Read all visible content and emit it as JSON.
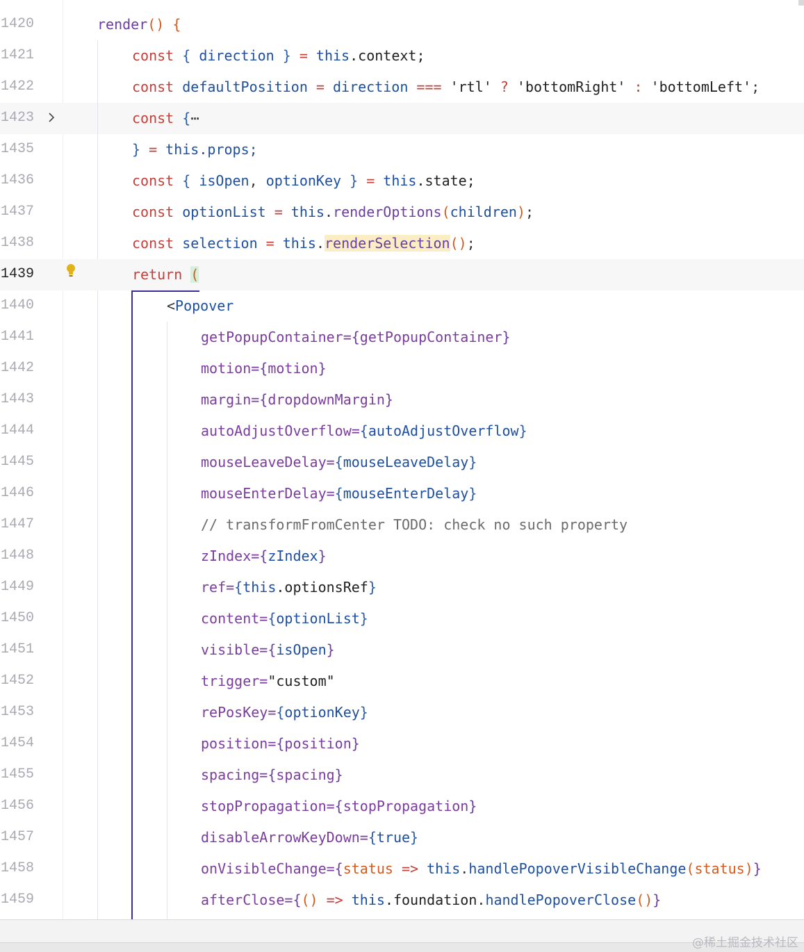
{
  "editor": {
    "current_line": "1439",
    "lines": [
      {
        "num": "1420",
        "hl": false
      },
      {
        "num": "1421",
        "hl": false
      },
      {
        "num": "1422",
        "hl": false
      },
      {
        "num": "1423",
        "hl": true,
        "folded": true
      },
      {
        "num": "1435",
        "hl": false
      },
      {
        "num": "1436",
        "hl": false
      },
      {
        "num": "1437",
        "hl": false
      },
      {
        "num": "1438",
        "hl": false
      },
      {
        "num": "1439",
        "hl": true,
        "current": true,
        "lightbulb": true
      },
      {
        "num": "1440",
        "hl": false
      },
      {
        "num": "1441",
        "hl": false
      },
      {
        "num": "1442",
        "hl": false
      },
      {
        "num": "1443",
        "hl": false
      },
      {
        "num": "1444",
        "hl": false
      },
      {
        "num": "1445",
        "hl": false
      },
      {
        "num": "1446",
        "hl": false
      },
      {
        "num": "1447",
        "hl": false
      },
      {
        "num": "1448",
        "hl": false
      },
      {
        "num": "1449",
        "hl": false
      },
      {
        "num": "1450",
        "hl": false
      },
      {
        "num": "1451",
        "hl": false
      },
      {
        "num": "1452",
        "hl": false
      },
      {
        "num": "1453",
        "hl": false
      },
      {
        "num": "1454",
        "hl": false
      },
      {
        "num": "1455",
        "hl": false
      },
      {
        "num": "1456",
        "hl": false
      },
      {
        "num": "1457",
        "hl": false
      },
      {
        "num": "1458",
        "hl": false
      },
      {
        "num": "1459",
        "hl": false
      }
    ],
    "code": {
      "l1420": {
        "fn": "render",
        "p1": "()",
        "b": " {"
      },
      "l1421": {
        "kw": "const",
        "o": " { ",
        "v": "direction",
        "c": " } ",
        "eq": "=",
        "th": " this",
        "rest": ".context;"
      },
      "l1422": {
        "kw": "const",
        "v1": " defaultPosition ",
        "eq": "=",
        "v2": " direction ",
        "op": "===",
        "s1": " 'rtl' ",
        "q": "?",
        "s2": " 'bottomRight' ",
        "col": ":",
        "s3": " 'bottomLeft'",
        "end": ";"
      },
      "l1423": {
        "kw": "const",
        "b": " {",
        "ell": "⋯"
      },
      "l1435": {
        "b": "} ",
        "eq": "=",
        "th": " this",
        "rest": ".props;"
      },
      "l1436": {
        "kw": "const",
        "o": " { ",
        "v1": "isOpen",
        "cm": ", ",
        "v2": "optionKey",
        "c": " } ",
        "eq": "=",
        "th": " this",
        "rest": ".state;"
      },
      "l1437": {
        "kw": "const",
        "v": " optionList ",
        "eq": "=",
        "th": " this",
        "dot": ".",
        "m": "renderOptions",
        "p1": "(",
        "arg": "children",
        "p2": ")",
        "end": ";"
      },
      "l1438": {
        "kw": "const",
        "v": " selection ",
        "eq": "=",
        "th": " this",
        "dot": ".",
        "m": "renderSelection",
        "p": "()",
        "end": ";"
      },
      "l1439": {
        "kw": "return",
        "sp": " ",
        "p": "("
      },
      "l1440": {
        "lt": "<",
        "tag": "Popover"
      },
      "l1441": {
        "a": "getPopupContainer=",
        "bo": "{",
        "v": "getPopupContainer",
        "bc": "}"
      },
      "l1442": {
        "a": "motion=",
        "bo": "{",
        "v": "motion",
        "bc": "}"
      },
      "l1443": {
        "a": "margin=",
        "bo": "{",
        "v": "dropdownMargin",
        "bc": "}"
      },
      "l1444": {
        "a": "autoAdjustOverflow=",
        "bo": "{",
        "v": "autoAdjustOverflow",
        "bc": "}"
      },
      "l1445": {
        "a": "mouseLeaveDelay=",
        "bo": "{",
        "v": "mouseLeaveDelay",
        "bc": "}"
      },
      "l1446": {
        "a": "mouseEnterDelay=",
        "bo": "{",
        "v": "mouseEnterDelay",
        "bc": "}"
      },
      "l1447": {
        "cmt": "// transformFromCenter TODO: check no such property"
      },
      "l1448": {
        "a": "zIndex=",
        "bo": "{",
        "v": "zIndex",
        "bc": "}"
      },
      "l1449": {
        "a": "ref=",
        "bo": "{",
        "th": "this",
        "rest": ".optionsRef",
        "bc": "}"
      },
      "l1450": {
        "a": "content=",
        "bo": "{",
        "v": "optionList",
        "bc": "}"
      },
      "l1451": {
        "a": "visible=",
        "bo": "{",
        "v": "isOpen",
        "bc": "}"
      },
      "l1452": {
        "a": "trigger=",
        "s": "\"custom\""
      },
      "l1453": {
        "a": "rePosKey=",
        "bo": "{",
        "v": "optionKey",
        "bc": "}"
      },
      "l1454": {
        "a": "position=",
        "bo": "{",
        "v": "position",
        "bc": "}"
      },
      "l1455": {
        "a": "spacing=",
        "bo": "{",
        "v": "spacing",
        "bc": "}"
      },
      "l1456": {
        "a": "stopPropagation=",
        "bo": "{",
        "v": "stopPropagation",
        "bc": "}"
      },
      "l1457": {
        "a": "disableArrowKeyDown=",
        "bo": "{",
        "v": "true",
        "bc": "}"
      },
      "l1458": {
        "a": "onVisibleChange=",
        "bo": "{",
        "arg": "status",
        "ar": " =>",
        "th": " this",
        "dot": ".",
        "m": "handlePopoverVisibleChange",
        "p1": "(",
        "arg2": "status",
        "p2": ")",
        "bc": "}"
      },
      "l1459": {
        "a": "afterClose=",
        "bo": "{",
        "p": "()",
        "ar": " =>",
        "th": " this",
        "rest": ".foundation",
        "dot": ".",
        "m": "handlePopoverClose",
        "p2": "()",
        "bc": "}"
      }
    }
  },
  "watermark": "@稀土掘金技术社区",
  "colors": {
    "keyword": "#c2403a",
    "function": "#6a3ea1",
    "variable": "#1d4f9e",
    "attribute": "#7a3d9e",
    "paren": "#d15a1f"
  }
}
